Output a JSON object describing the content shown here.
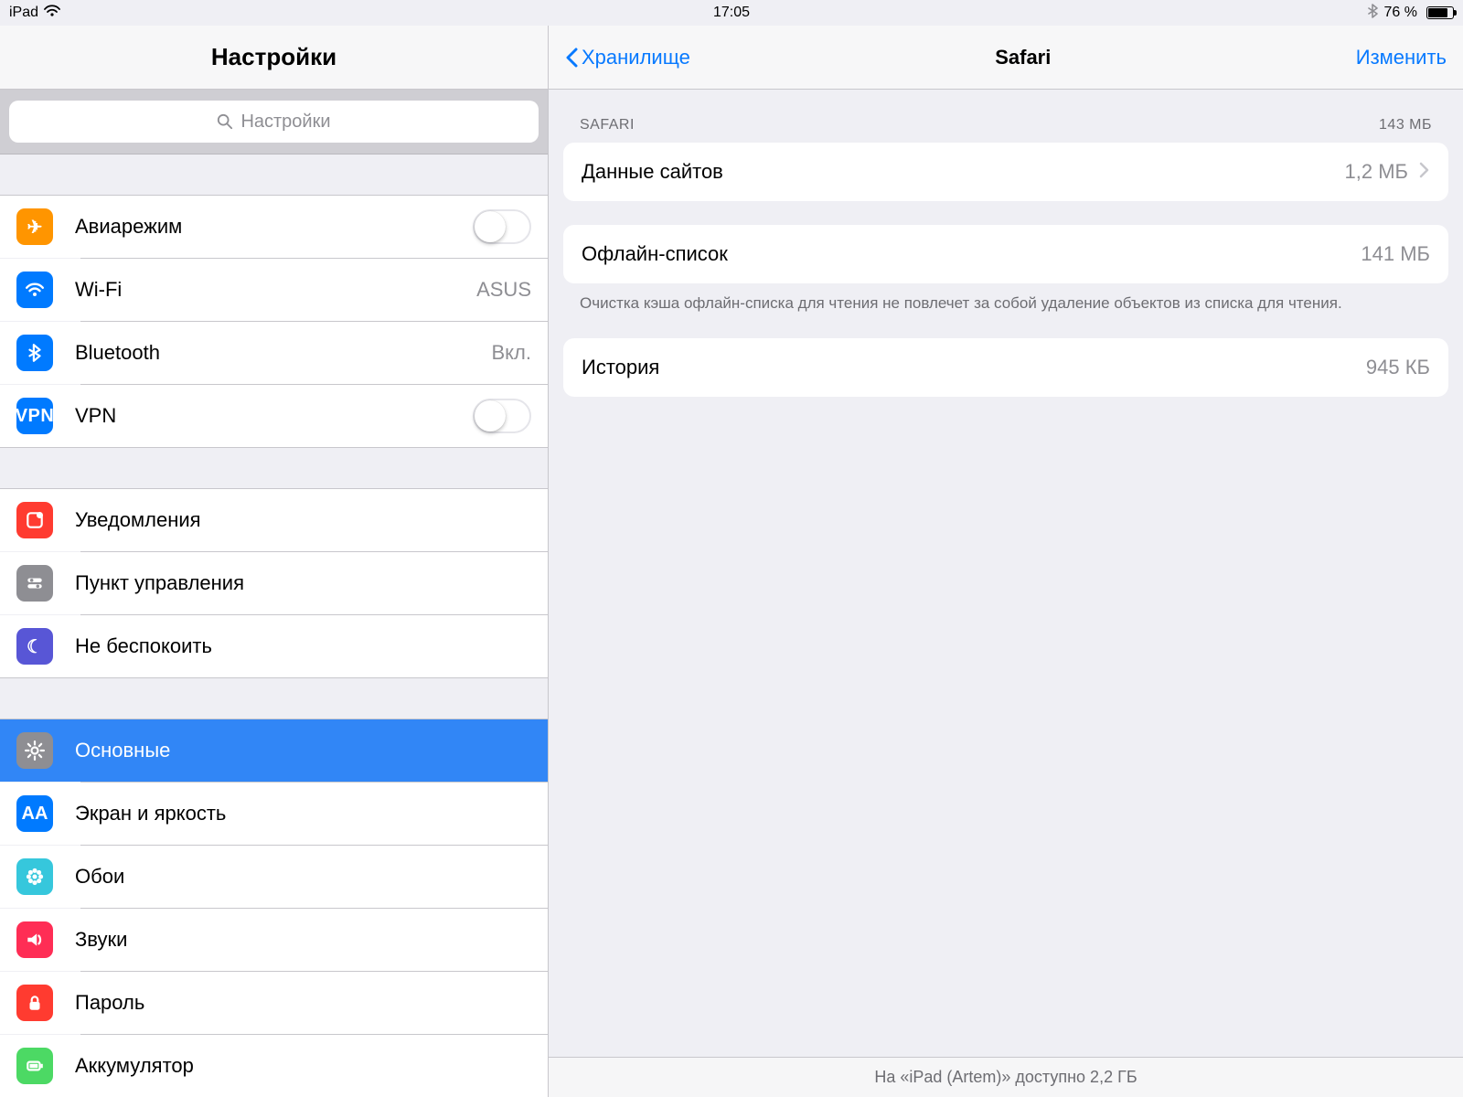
{
  "statusbar": {
    "device": "iPad",
    "time": "17:05",
    "battery_pct": "76 %"
  },
  "sidebar": {
    "title": "Настройки",
    "search_placeholder": "Настройки",
    "groups": [
      [
        {
          "key": "airplane",
          "icon": "ic-air",
          "glyph": "✈",
          "label": "Авиарежим",
          "value": "",
          "toggle": true
        },
        {
          "key": "wifi",
          "icon": "ic-wifi",
          "svg": "wifi",
          "label": "Wi-Fi",
          "value": "ASUS"
        },
        {
          "key": "bluetooth",
          "icon": "ic-bt",
          "svg": "bt",
          "label": "Bluetooth",
          "value": "Вкл."
        },
        {
          "key": "vpn",
          "icon": "ic-vpn",
          "glyph": "VPN",
          "label": "VPN",
          "value": "",
          "toggle": true
        }
      ],
      [
        {
          "key": "notifications",
          "icon": "ic-notif",
          "svg": "notif",
          "label": "Уведомления",
          "value": ""
        },
        {
          "key": "controlcenter",
          "icon": "ic-cc",
          "svg": "cc",
          "label": "Пункт управления",
          "value": ""
        },
        {
          "key": "dnd",
          "icon": "ic-dnd",
          "glyph": "☾",
          "label": "Не беспокоить",
          "value": ""
        }
      ],
      [
        {
          "key": "general",
          "icon": "ic-gen",
          "svg": "gear",
          "label": "Основные",
          "value": "",
          "selected": true
        },
        {
          "key": "display",
          "icon": "ic-disp",
          "glyph": "AA",
          "label": "Экран и яркость",
          "value": ""
        },
        {
          "key": "wallpaper",
          "icon": "ic-wall",
          "svg": "flower",
          "label": "Обои",
          "value": ""
        },
        {
          "key": "sounds",
          "icon": "ic-sound",
          "svg": "sound",
          "label": "Звуки",
          "value": ""
        },
        {
          "key": "passcode",
          "icon": "ic-pass",
          "svg": "lock",
          "label": "Пароль",
          "value": ""
        },
        {
          "key": "battery",
          "icon": "ic-batt",
          "svg": "batt",
          "label": "Аккумулятор",
          "value": ""
        }
      ]
    ]
  },
  "detail": {
    "back_label": "Хранилище",
    "title": "Safari",
    "edit_label": "Изменить",
    "section_header": "SAFARI",
    "section_total": "143 МБ",
    "rows1": [
      {
        "key": "sitedata",
        "label": "Данные сайтов",
        "value": "1,2 МБ",
        "chevron": true
      }
    ],
    "rows2": [
      {
        "key": "offline",
        "label": "Офлайн-список",
        "value": "141 МБ",
        "chevron": false
      }
    ],
    "note": "Очистка кэша офлайн-списка для чтения не повлечет за собой удаление объектов из списка для чтения.",
    "rows3": [
      {
        "key": "history",
        "label": "История",
        "value": "945 КБ",
        "chevron": false
      }
    ],
    "footer": "На «iPad (Artem)» доступно 2,2 ГБ"
  }
}
